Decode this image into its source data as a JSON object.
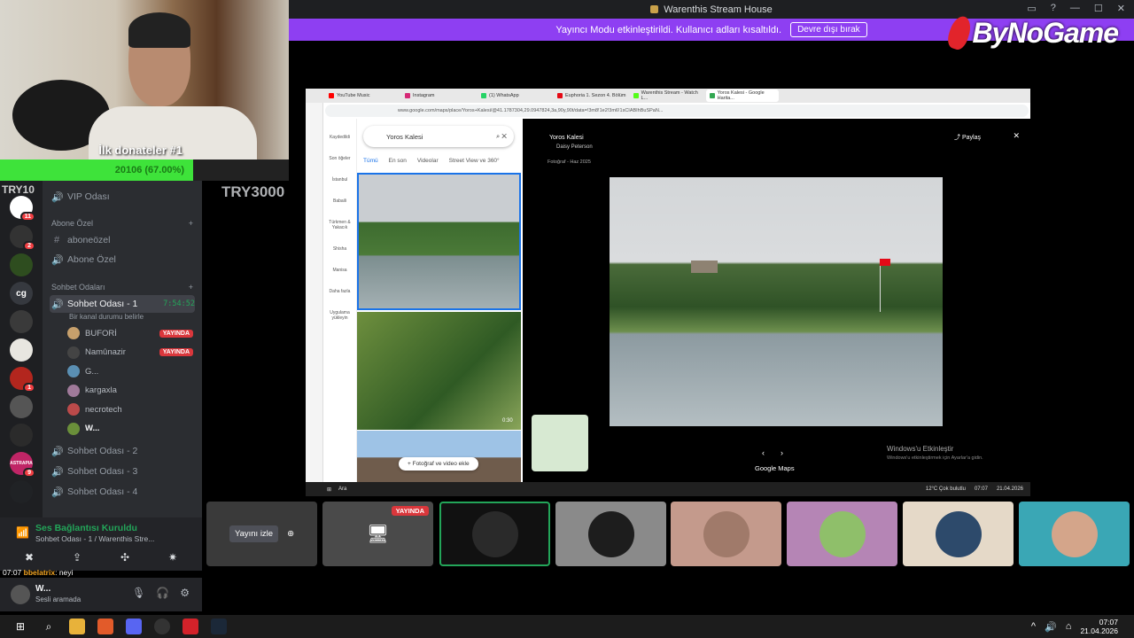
{
  "window": {
    "title": "Warenthis Stream House",
    "controls": [
      "▭",
      "?",
      "—",
      "☐",
      "✕"
    ]
  },
  "banner": {
    "text": "Yayıncı Modu etkinleştirildi. Kullanıcı adları kısaltıldı.",
    "button": "Devre dışı bırak"
  },
  "overlay": {
    "brand": "ByNoGame",
    "donor": "İlk donateler #1",
    "goal_text": "20106 (67.00%)",
    "goal_fraction": 0.67,
    "left_tag": "TRY10",
    "right_tag": "TRY3000"
  },
  "servers": [
    {
      "label": "",
      "badge": "11"
    },
    {
      "label": "",
      "badge": "2"
    },
    {
      "label": "",
      "badge": ""
    },
    {
      "label": "cg",
      "badge": ""
    },
    {
      "label": "",
      "badge": ""
    },
    {
      "label": "",
      "badge": ""
    },
    {
      "label": "",
      "badge": "1"
    },
    {
      "label": "",
      "badge": ""
    },
    {
      "label": "",
      "badge": ""
    },
    {
      "label": "ASTRAPIA",
      "badge": "9"
    },
    {
      "label": "",
      "badge": ""
    }
  ],
  "channels": {
    "vip": "VIP Odası",
    "category_abone": "Abone Özel",
    "aboneozel_text": "aboneözel",
    "abone_voice": "Abone Özel",
    "category_sohbet": "Sohbet Odaları",
    "active_room": "Sohbet Odası - 1",
    "active_time": "7:54:52",
    "active_status": "Bir kanal durumu belirle",
    "users": [
      {
        "name": "BUFORİ",
        "live": "YAYINDA"
      },
      {
        "name": "Namûnazir",
        "live": "YAYINDA"
      },
      {
        "name": "G...",
        "live": ""
      },
      {
        "name": "kargaxla",
        "live": ""
      },
      {
        "name": "necrotech",
        "live": ""
      },
      {
        "name": "W...",
        "live": ""
      }
    ],
    "room2": "Sohbet Odası - 2",
    "room3": "Sohbet Odası - 3",
    "room4": "Sohbet Odası - 4"
  },
  "voice": {
    "connected": "Ses Bağlantısı Kuruldu",
    "room": "Sohbet Odası - 1 / Warenthis Stre..."
  },
  "chat": {
    "time": "07:07",
    "user": "bbelatrix",
    "msg": ": neyi"
  },
  "me": {
    "name": "W...",
    "status": "Sesli aramada"
  },
  "browser": {
    "tabs": [
      "YouTube Music",
      "Instagram",
      "(1) WhatsApp",
      "Euphoria 1. Sezon 4. Bölüm",
      "Warenthis Stream - Watch L...",
      "Yoros Kalesi - Google Harita..."
    ],
    "url": "www.google.com/maps/place/Yoros+Kalesi/@41.1787304,29.0947824,3a,90y,90t/data=!3m8!1e2!3m6!1sCIABIhBuSPaN..."
  },
  "maps": {
    "search": "Yoros Kalesi",
    "tabs": [
      "Tümü",
      "En son",
      "Videolar",
      "Street View ve 360°"
    ],
    "side": [
      "Kaydedildi",
      "Son öğeler",
      "İstanbul",
      "Babaili",
      "Türkmen & Yakacık",
      "Shisha",
      "Manisa",
      "Daha fazla",
      "Uygulama yükleyin"
    ],
    "duration": "0:30",
    "add_photo": "+ Fotoğraf ve video ekle",
    "title": "Yoros Kalesi",
    "author": "Daisy Peterson",
    "date": "Fotoğraf - Haz 2025",
    "share": "Paylaş",
    "footer": "Google Maps",
    "activate": "Windows'u Etkinleştir",
    "activate_sub": "Windows'u etkinleştirmek için Ayarlar'a gidin."
  },
  "stream_taskbar": {
    "search": "Ara",
    "weather": "12°C Çok bulutlu",
    "time": "07:07",
    "date": "21.04.2026"
  },
  "tiles": {
    "watch": "Yayını izle",
    "live": "YAYINDA"
  },
  "taskbar": {
    "time": "07:07",
    "date": "21.04.2026"
  },
  "colors": {
    "accent": "#8e3ff2",
    "live": "#da373c",
    "online": "#23a559",
    "goal": "#3ee33a"
  }
}
